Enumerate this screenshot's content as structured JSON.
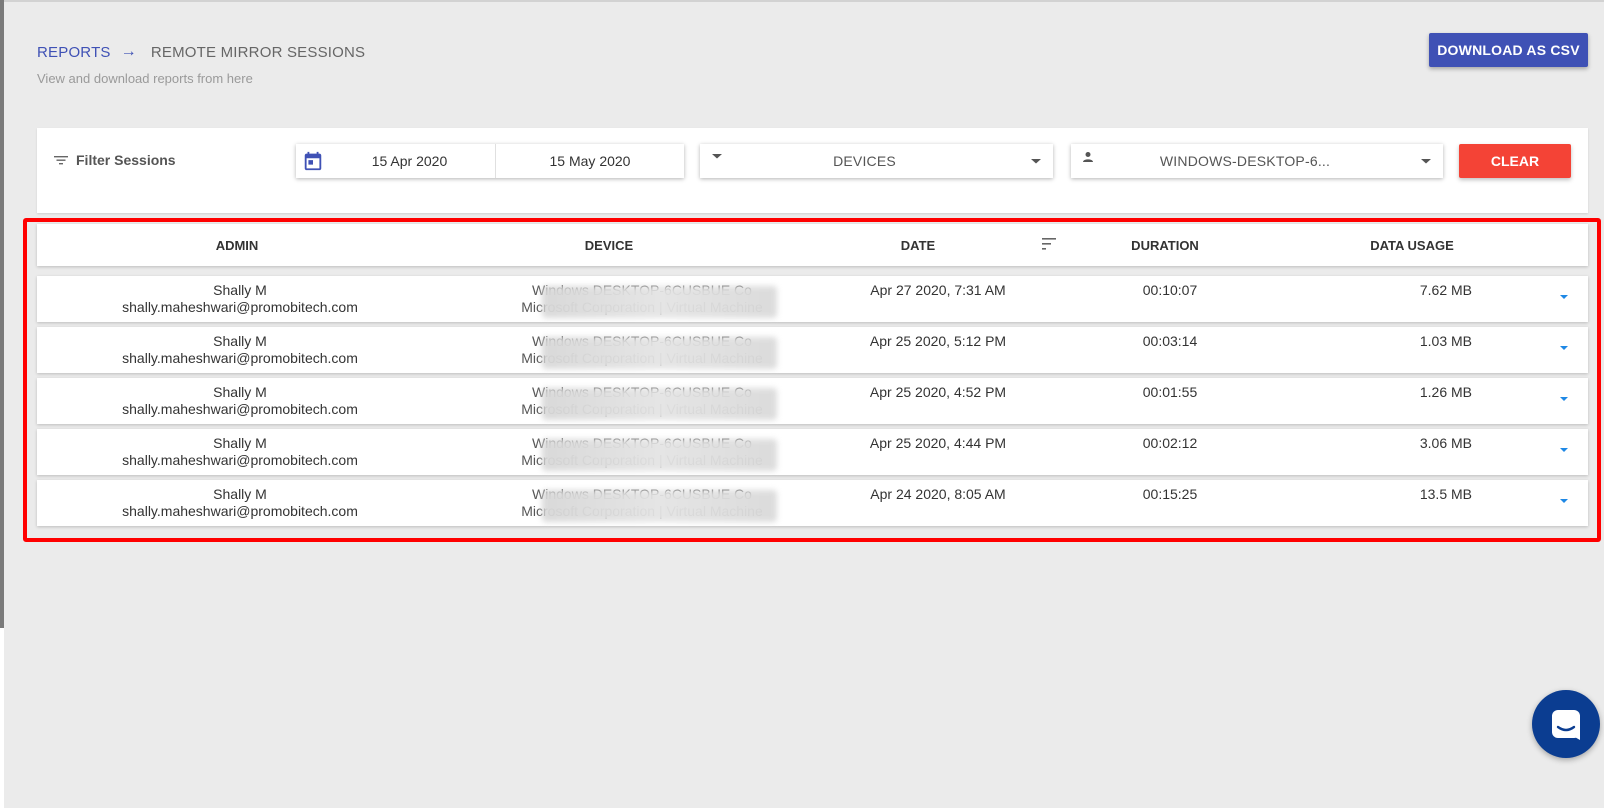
{
  "breadcrumb": {
    "parent": "REPORTS",
    "current": "REMOTE MIRROR SESSIONS",
    "subtitle": "View and download reports from here"
  },
  "toolbar": {
    "download_label": "DOWNLOAD AS CSV"
  },
  "filters": {
    "title": "Filter Sessions",
    "date_from": "15 Apr 2020",
    "date_to": "15 May 2020",
    "devices_label": "DEVICES",
    "user_label": "WINDOWS-DESKTOP-6...",
    "clear_label": "CLEAR"
  },
  "table": {
    "columns": [
      "ADMIN",
      "DEVICE",
      "DATE",
      "DURATION",
      "DATA USAGE"
    ],
    "rows": [
      {
        "admin_name": "Shally M",
        "admin_email": "shally.maheshwari@promobitech.com",
        "device_line1": "Windows DESKTOP-6CUSBUE Co",
        "device_line2": "Microsoft Corporation | Virtual Machine",
        "date": "Apr 27 2020, 7:31 AM",
        "duration": "00:10:07",
        "data_usage": "7.62 MB"
      },
      {
        "admin_name": "Shally M",
        "admin_email": "shally.maheshwari@promobitech.com",
        "device_line1": "Windows DESKTOP-6CUSBUE Co",
        "device_line2": "Microsoft Corporation | Virtual Machine",
        "date": "Apr 25 2020, 5:12 PM",
        "duration": "00:03:14",
        "data_usage": "1.03 MB"
      },
      {
        "admin_name": "Shally M",
        "admin_email": "shally.maheshwari@promobitech.com",
        "device_line1": "Windows DESKTOP-6CUSBUE Co",
        "device_line2": "Microsoft Corporation | Virtual Machine",
        "date": "Apr 25 2020, 4:52 PM",
        "duration": "00:01:55",
        "data_usage": "1.26 MB"
      },
      {
        "admin_name": "Shally M",
        "admin_email": "shally.maheshwari@promobitech.com",
        "device_line1": "Windows DESKTOP-6CUSBUE Co",
        "device_line2": "Microsoft Corporation | Virtual Machine",
        "date": "Apr 25 2020, 4:44 PM",
        "duration": "00:02:12",
        "data_usage": "3.06 MB"
      },
      {
        "admin_name": "Shally M",
        "admin_email": "shally.maheshwari@promobitech.com",
        "device_line1": "Windows DESKTOP-6CUSBUE Co",
        "device_line2": "Microsoft Corporation | Virtual Machine",
        "date": "Apr 24 2020, 8:05 AM",
        "duration": "00:15:25",
        "data_usage": "13.5 MB"
      }
    ]
  },
  "colors": {
    "primary": "#3f51b5",
    "danger": "#f44336",
    "highlight": "#ff0000",
    "chat": "#0b3d91",
    "expand": "#1e88e5"
  },
  "icons": {
    "filter": "filter-list-icon",
    "calendar": "calendar-icon",
    "caret": "caret-down-icon",
    "person": "person-icon",
    "sort": "sort-icon",
    "chat": "chat-bubble-icon"
  }
}
